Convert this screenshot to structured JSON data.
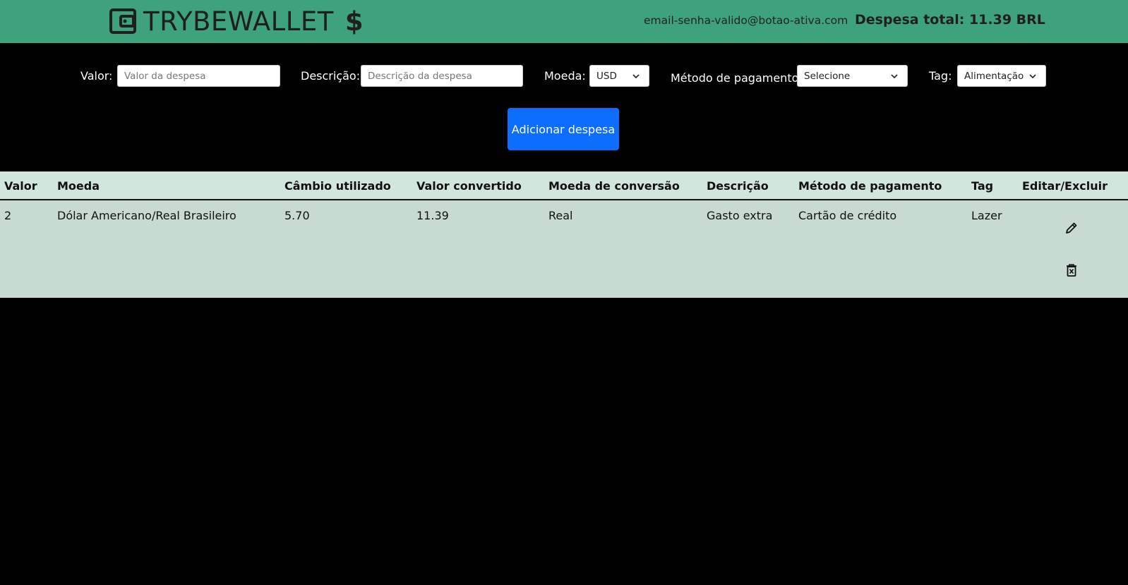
{
  "header": {
    "logo_text": "TRYBEWALLET",
    "logo_symbol": "$",
    "email": "email-senha-valido@botao-ativa.com",
    "total": "Despesa total: 11.39 BRL"
  },
  "form": {
    "valor_label": "Valor:",
    "valor_placeholder": "Valor da despesa",
    "descricao_label": "Descrição:",
    "descricao_placeholder": "Descrição da despesa",
    "moeda_label": "Moeda:",
    "moeda_value": "USD",
    "metodo_label": "Método de pagamento:",
    "metodo_value": "Selecione",
    "tag_label": "Tag:",
    "tag_value": "Alimentação",
    "add_button": "Adicionar despesa"
  },
  "table": {
    "headers": [
      "Valor",
      "Moeda",
      "Câmbio utilizado",
      "Valor convertido",
      "Moeda de conversão",
      "Descrição",
      "Método de pagamento",
      "Tag",
      "Editar/Excluir"
    ],
    "rows": [
      [
        "2",
        "Dólar Americano/Real Brasileiro",
        "5.70",
        "11.39",
        "Real",
        "Gasto extra",
        "Cartão de crédito",
        "Lazer"
      ]
    ]
  },
  "colors": {
    "header_bg": "#3ea27c",
    "button_bg": "#0d6efd",
    "table_header_bg": "#d1e7dd",
    "table_row_bg": "#c7dbd2"
  }
}
